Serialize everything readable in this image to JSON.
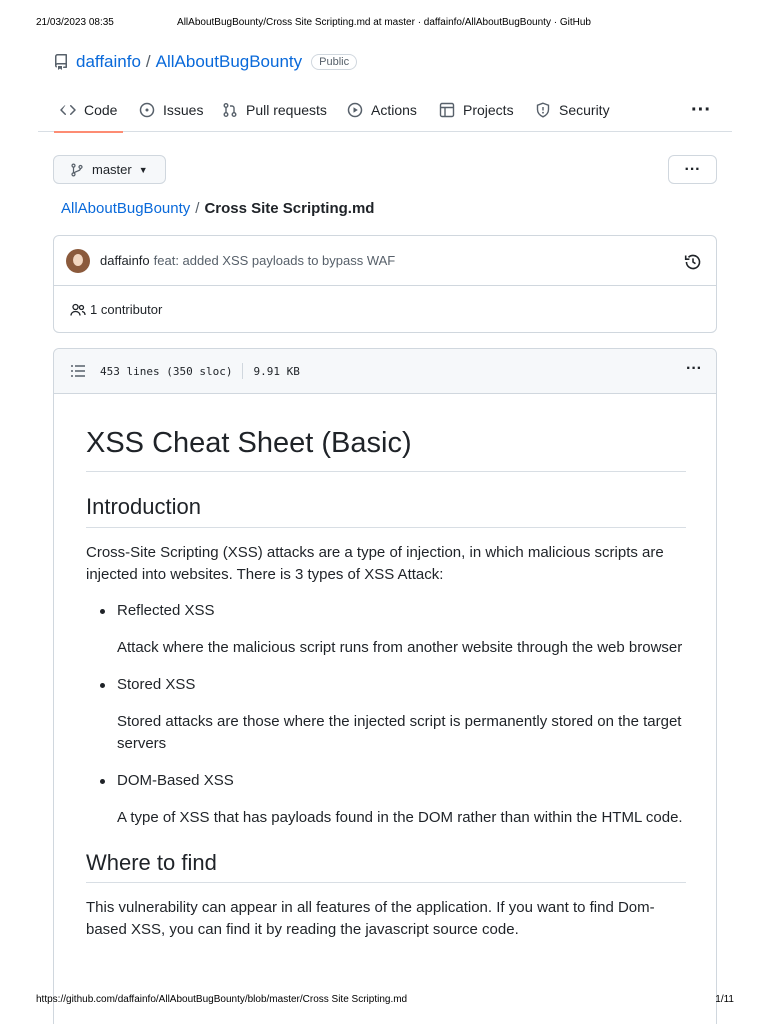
{
  "print": {
    "date": "21/03/2023 08:35",
    "title": "AllAboutBugBounty/Cross Site Scripting.md at master · daffainfo/AllAboutBugBounty · GitHub",
    "url": "https://github.com/daffainfo/AllAboutBugBounty/blob/master/Cross Site Scripting.md",
    "page": "1/11"
  },
  "repo": {
    "owner": "daffainfo",
    "separator": "/",
    "name": "AllAboutBugBounty",
    "visibility": "Public",
    "icon": "repo-icon"
  },
  "tabs": [
    {
      "label": "Code",
      "icon": "code-icon",
      "selected": true
    },
    {
      "label": "Issues",
      "icon": "issue-opened-icon"
    },
    {
      "label": "Pull requests",
      "icon": "git-pull-request-icon"
    },
    {
      "label": "Actions",
      "icon": "play-icon"
    },
    {
      "label": "Projects",
      "icon": "table-icon"
    },
    {
      "label": "Security",
      "icon": "shield-icon"
    }
  ],
  "tabs_more": "···",
  "branch": {
    "name": "master",
    "icon": "git-branch-icon"
  },
  "more_button": "···",
  "breadcrumb": {
    "repo": "AllAboutBugBounty",
    "separator": "/",
    "file": "Cross Site Scripting.md"
  },
  "commit": {
    "author": "daffainfo",
    "message": "feat: added XSS payloads to bypass WAF",
    "history_icon": "history-icon"
  },
  "contributors": {
    "count": "1",
    "label": "contributor",
    "icon": "people-icon"
  },
  "file": {
    "lines": "453 lines (350 sloc)",
    "size": "9.91 KB",
    "more": "···",
    "toc_icon": "list-unordered-icon"
  },
  "content": {
    "h1": "XSS Cheat Sheet (Basic)",
    "intro_heading": "Introduction",
    "intro_text": "Cross-Site Scripting (XSS) attacks are a type of injection, in which malicious scripts are injected into websites. There is 3 types of XSS Attack:",
    "types": [
      {
        "name": "Reflected XSS",
        "desc": "Attack where the malicious script runs from another website through the web browser"
      },
      {
        "name": "Stored XSS",
        "desc": "Stored attacks are those where the injected script is permanently stored on the target servers"
      },
      {
        "name": "DOM-Based XSS",
        "desc": "A type of XSS that has payloads found in the DOM rather than within the HTML code."
      }
    ],
    "where_heading": "Where to find",
    "where_text": "This vulnerability can appear in all features of the application. If you want to find Dom-based XSS, you can find it by reading the javascript source code."
  },
  "colors": {
    "link": "#0969da",
    "text": "#1f2328",
    "muted": "#57606a",
    "border": "#d0d7de",
    "tab_underline": "#fd8c73"
  }
}
